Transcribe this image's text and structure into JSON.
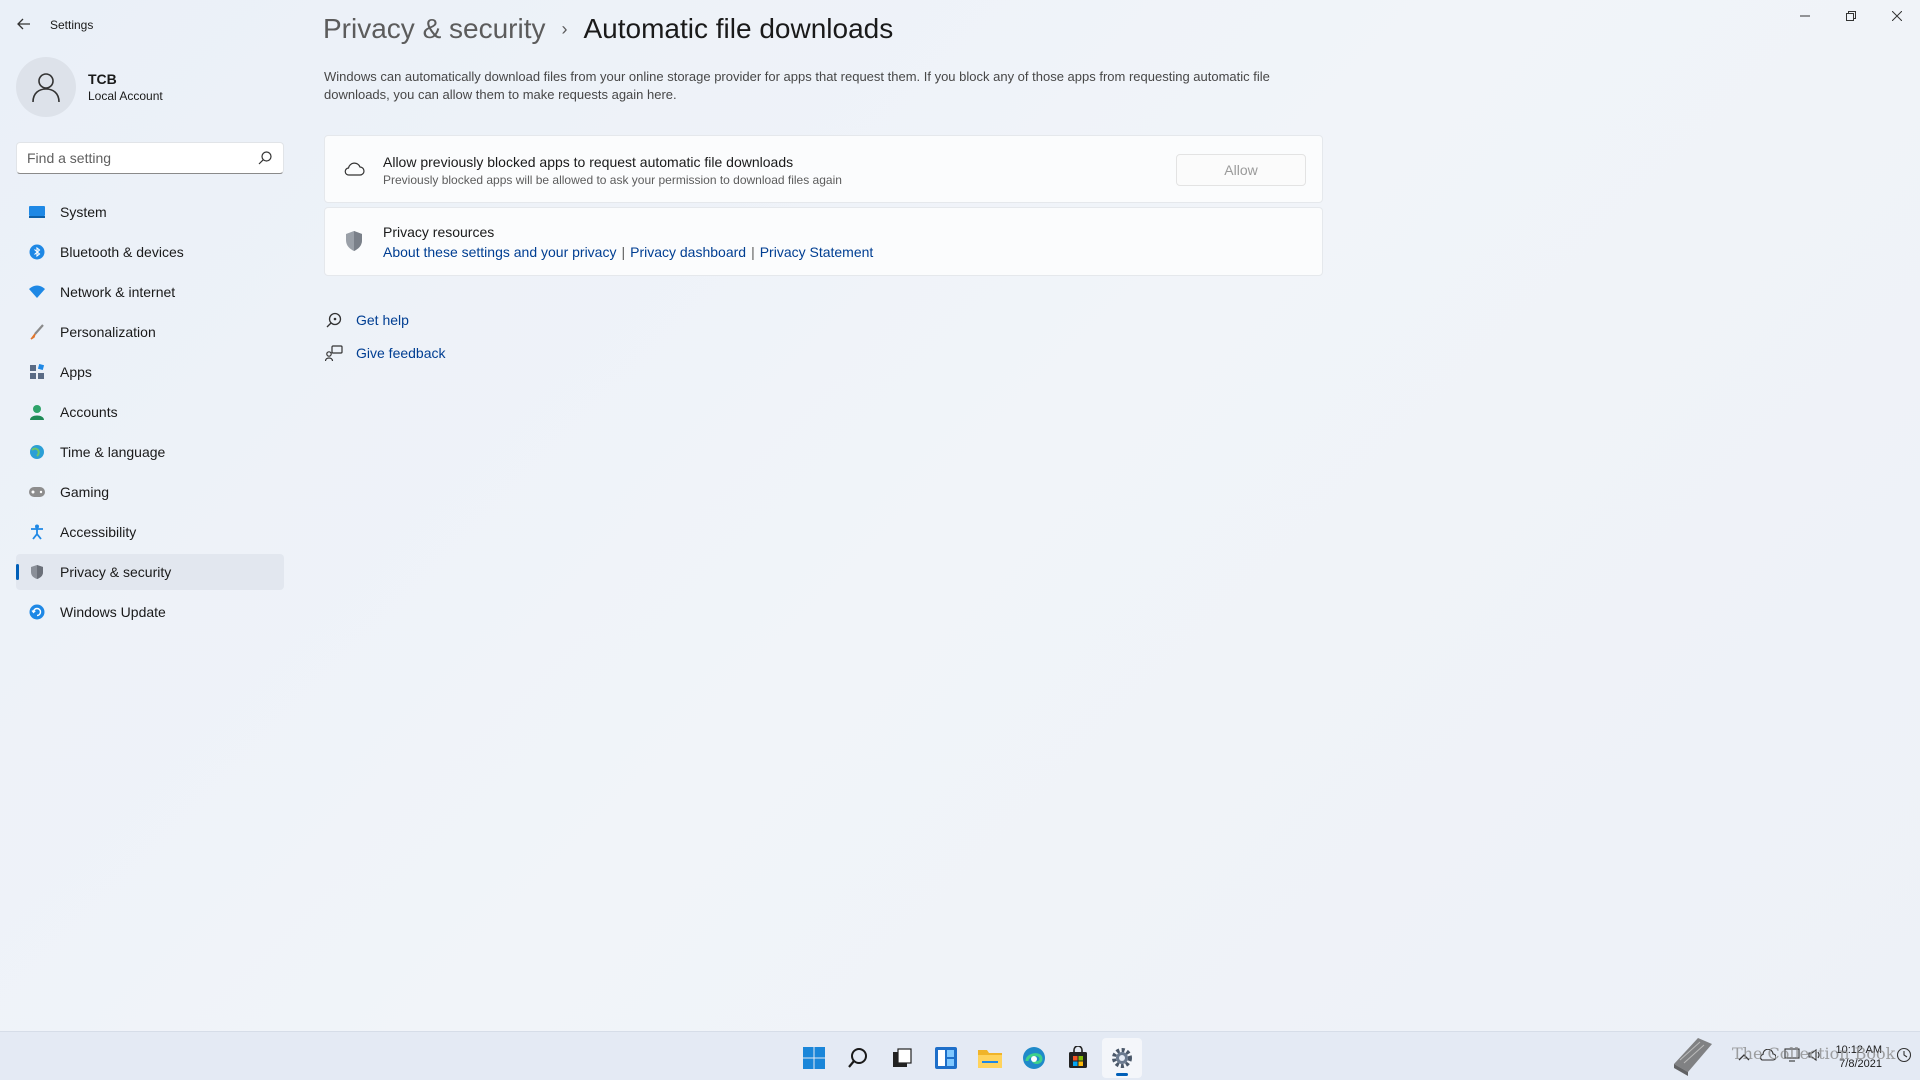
{
  "window": {
    "app_title": "Settings"
  },
  "profile": {
    "name": "TCB",
    "account_type": "Local Account"
  },
  "search": {
    "placeholder": "Find a setting"
  },
  "sidebar": {
    "items": [
      {
        "label": "System",
        "icon": "system-icon"
      },
      {
        "label": "Bluetooth & devices",
        "icon": "bluetooth-icon"
      },
      {
        "label": "Network & internet",
        "icon": "network-icon"
      },
      {
        "label": "Personalization",
        "icon": "brush-icon"
      },
      {
        "label": "Apps",
        "icon": "apps-icon"
      },
      {
        "label": "Accounts",
        "icon": "accounts-icon"
      },
      {
        "label": "Time & language",
        "icon": "time-language-icon"
      },
      {
        "label": "Gaming",
        "icon": "gaming-icon"
      },
      {
        "label": "Accessibility",
        "icon": "accessibility-icon"
      },
      {
        "label": "Privacy & security",
        "icon": "shield-icon",
        "selected": true
      },
      {
        "label": "Windows Update",
        "icon": "windows-update-icon"
      }
    ]
  },
  "breadcrumb": {
    "parent": "Privacy & security",
    "separator": "›",
    "current": "Automatic file downloads"
  },
  "description": "Windows can automatically download files from your online storage provider for apps that request them. If you block any of those apps from requesting automatic file downloads, you can allow them to make requests again here.",
  "allow_card": {
    "title": "Allow previously blocked apps to request automatic file downloads",
    "subtitle": "Previously blocked apps will be allowed to ask your permission to download files again",
    "button_label": "Allow"
  },
  "privacy_card": {
    "title": "Privacy resources",
    "links": [
      "About these settings and your privacy",
      "Privacy dashboard",
      "Privacy Statement"
    ],
    "link_separator": "|"
  },
  "help": {
    "get_help": "Get help",
    "give_feedback": "Give feedback"
  },
  "taskbar": {
    "apps": [
      "start-icon",
      "search-icon",
      "task-view-icon",
      "widgets-icon",
      "file-explorer-icon",
      "edge-icon",
      "store-icon",
      "settings-icon"
    ],
    "active_app": "settings-icon"
  },
  "tray": {
    "time": "10:12 AM",
    "date": "7/8/2021"
  },
  "watermark": {
    "text": "The Collection Book"
  },
  "colors": {
    "accent": "#005fb8",
    "link": "#003e92",
    "background": "#eef2f8"
  }
}
